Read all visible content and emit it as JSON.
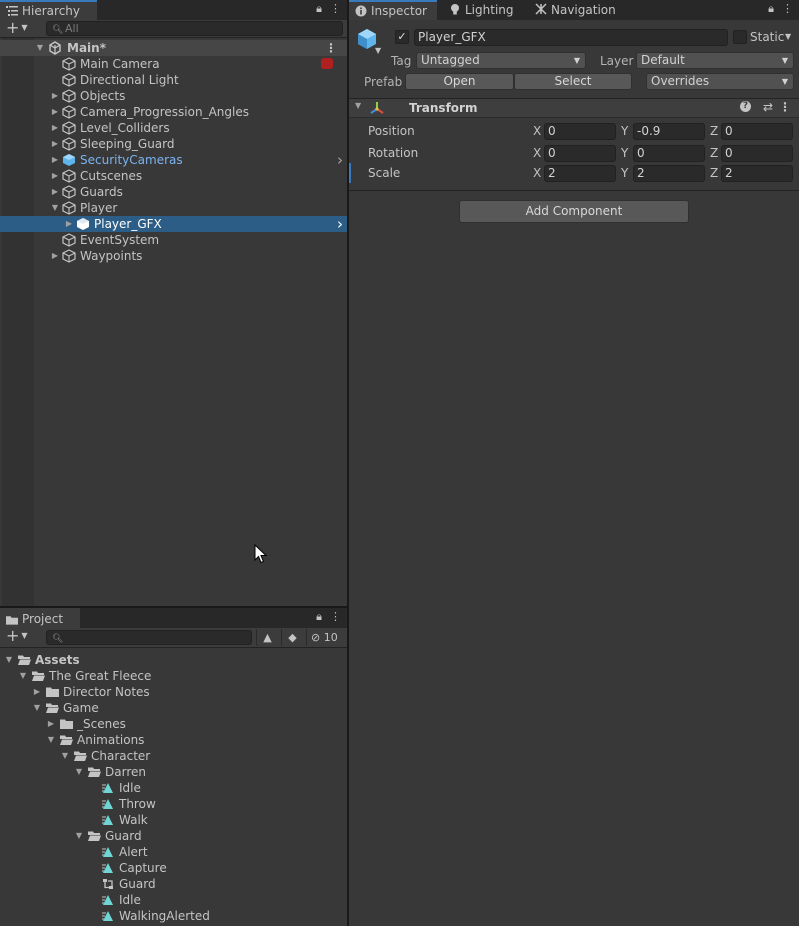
{
  "hierarchy": {
    "tab_label": "Hierarchy",
    "search_placeholder": "All",
    "scene_name": "Main*",
    "items": [
      {
        "label": "Main Camera",
        "depth": 1,
        "expander": "",
        "prefab": false,
        "selected": false
      },
      {
        "label": "Directional Light",
        "depth": 1,
        "expander": "",
        "prefab": false,
        "selected": false
      },
      {
        "label": "Objects",
        "depth": 1,
        "expander": "collapsed",
        "prefab": false,
        "selected": false
      },
      {
        "label": "Camera_Progression_Angles",
        "depth": 1,
        "expander": "collapsed",
        "prefab": false,
        "selected": false
      },
      {
        "label": "Level_Colliders",
        "depth": 1,
        "expander": "collapsed",
        "prefab": false,
        "selected": false
      },
      {
        "label": "Sleeping_Guard",
        "depth": 1,
        "expander": "collapsed",
        "prefab": false,
        "selected": false
      },
      {
        "label": "SecurityCameras",
        "depth": 1,
        "expander": "collapsed",
        "prefab": true,
        "selected": false
      },
      {
        "label": "Cutscenes",
        "depth": 1,
        "expander": "collapsed",
        "prefab": false,
        "selected": false
      },
      {
        "label": "Guards",
        "depth": 1,
        "expander": "collapsed",
        "prefab": false,
        "selected": false
      },
      {
        "label": "Player",
        "depth": 1,
        "expander": "expanded",
        "prefab": false,
        "selected": false
      },
      {
        "label": "Player_GFX",
        "depth": 2,
        "expander": "collapsed",
        "prefab": true,
        "selected": true
      },
      {
        "label": "EventSystem",
        "depth": 1,
        "expander": "",
        "prefab": false,
        "selected": false
      },
      {
        "label": "Waypoints",
        "depth": 1,
        "expander": "collapsed",
        "prefab": false,
        "selected": false
      }
    ]
  },
  "project": {
    "tab_label": "Project",
    "search_placeholder": "",
    "hidden_count": "10",
    "items": [
      {
        "label": "Assets",
        "depth": 0,
        "expander": "expanded",
        "kind": "folder-open",
        "bold": true
      },
      {
        "label": "The Great Fleece",
        "depth": 1,
        "expander": "expanded",
        "kind": "folder-open",
        "bold": false
      },
      {
        "label": "Director Notes",
        "depth": 2,
        "expander": "collapsed",
        "kind": "folder",
        "bold": false
      },
      {
        "label": "Game",
        "depth": 2,
        "expander": "expanded",
        "kind": "folder-open",
        "bold": false
      },
      {
        "label": "_Scenes",
        "depth": 3,
        "expander": "collapsed",
        "kind": "folder",
        "bold": false
      },
      {
        "label": "Animations",
        "depth": 3,
        "expander": "expanded",
        "kind": "folder-open",
        "bold": false
      },
      {
        "label": "Character",
        "depth": 4,
        "expander": "expanded",
        "kind": "folder-open",
        "bold": false
      },
      {
        "label": "Darren",
        "depth": 5,
        "expander": "expanded",
        "kind": "folder-open",
        "bold": false
      },
      {
        "label": "Idle",
        "depth": 6,
        "expander": "",
        "kind": "anim",
        "bold": false
      },
      {
        "label": "Throw",
        "depth": 6,
        "expander": "",
        "kind": "anim",
        "bold": false
      },
      {
        "label": "Walk",
        "depth": 6,
        "expander": "",
        "kind": "anim",
        "bold": false
      },
      {
        "label": "Guard",
        "depth": 5,
        "expander": "expanded",
        "kind": "folder-open",
        "bold": false
      },
      {
        "label": "Alert",
        "depth": 6,
        "expander": "",
        "kind": "anim",
        "bold": false
      },
      {
        "label": "Capture",
        "depth": 6,
        "expander": "",
        "kind": "anim",
        "bold": false
      },
      {
        "label": "Guard",
        "depth": 6,
        "expander": "",
        "kind": "controller",
        "bold": false
      },
      {
        "label": "Idle",
        "depth": 6,
        "expander": "",
        "kind": "anim",
        "bold": false
      },
      {
        "label": "WalkingAlerted",
        "depth": 6,
        "expander": "",
        "kind": "anim",
        "bold": false
      }
    ]
  },
  "inspector": {
    "tabs": [
      {
        "label": "Inspector",
        "icon": "info-icon"
      },
      {
        "label": "Lighting",
        "icon": "bulb-icon"
      },
      {
        "label": "Navigation",
        "icon": "navmesh-icon"
      }
    ],
    "object_name": "Player_GFX",
    "active_checked": true,
    "static_label": "Static",
    "tag_label": "Tag",
    "tag_value": "Untagged",
    "layer_label": "Layer",
    "layer_value": "Default",
    "prefab_label": "Prefab",
    "open_label": "Open",
    "select_label": "Select",
    "overrides_label": "Overrides",
    "component_title": "Transform",
    "rows": [
      {
        "name": "Position",
        "x": "0",
        "y": "-0.9",
        "z": "0"
      },
      {
        "name": "Rotation",
        "x": "0",
        "y": "0",
        "z": "0"
      },
      {
        "name": "Scale",
        "x": "2",
        "y": "2",
        "z": "2"
      }
    ],
    "axis_x": "X",
    "axis_y": "Y",
    "axis_z": "Z",
    "add_component_label": "Add Component"
  },
  "colors": {
    "selection": "#2c5d87",
    "prefab_text": "#7bb3ef",
    "accent_tab": "#3a79bb",
    "anim_icon": "#6fd6d6"
  }
}
